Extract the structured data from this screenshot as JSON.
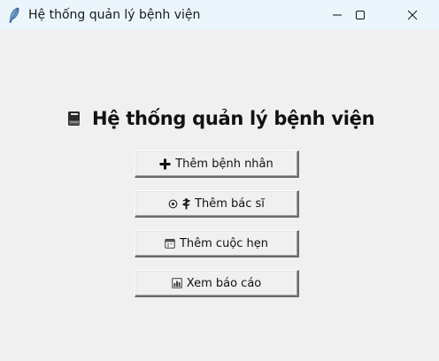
{
  "window": {
    "title": "Hệ thống quản lý bệnh viện",
    "app_icon": "feather-icon",
    "controls": [
      "minimize-icon",
      "maximize-icon",
      "close-icon"
    ]
  },
  "main": {
    "heading": "Hệ thống quản lý bệnh viện",
    "heading_icon": "ledger-icon",
    "buttons": [
      {
        "label": "Thêm bệnh nhân",
        "icons": [
          "plus-icon"
        ]
      },
      {
        "label": "Thêm bác sĩ",
        "icons": [
          "stethoscope-icon",
          "medical-symbol-icon"
        ]
      },
      {
        "label": "Thêm cuộc hẹn",
        "icons": [
          "calendar-icon"
        ]
      },
      {
        "label": "Xem báo cáo",
        "icons": [
          "bar-chart-icon"
        ]
      }
    ]
  },
  "colors": {
    "background": "#f0f0f0",
    "titlebar": "#eaf6fb",
    "text": "#111111"
  }
}
